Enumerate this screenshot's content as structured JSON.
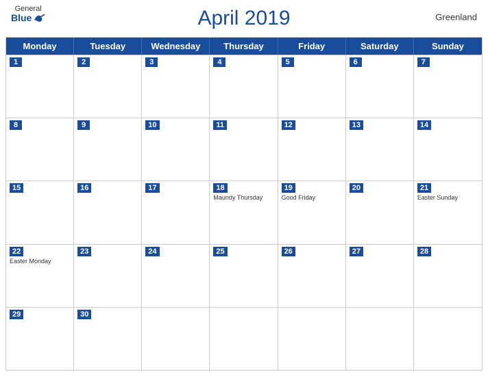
{
  "header": {
    "logo_general": "General",
    "logo_blue": "Blue",
    "title": "April 2019",
    "region": "Greenland"
  },
  "day_headers": [
    "Monday",
    "Tuesday",
    "Wednesday",
    "Thursday",
    "Friday",
    "Saturday",
    "Sunday"
  ],
  "weeks": [
    [
      {
        "date": "1",
        "holiday": ""
      },
      {
        "date": "2",
        "holiday": ""
      },
      {
        "date": "3",
        "holiday": ""
      },
      {
        "date": "4",
        "holiday": ""
      },
      {
        "date": "5",
        "holiday": ""
      },
      {
        "date": "6",
        "holiday": ""
      },
      {
        "date": "7",
        "holiday": ""
      }
    ],
    [
      {
        "date": "8",
        "holiday": ""
      },
      {
        "date": "9",
        "holiday": ""
      },
      {
        "date": "10",
        "holiday": ""
      },
      {
        "date": "11",
        "holiday": ""
      },
      {
        "date": "12",
        "holiday": ""
      },
      {
        "date": "13",
        "holiday": ""
      },
      {
        "date": "14",
        "holiday": ""
      }
    ],
    [
      {
        "date": "15",
        "holiday": ""
      },
      {
        "date": "16",
        "holiday": ""
      },
      {
        "date": "17",
        "holiday": ""
      },
      {
        "date": "18",
        "holiday": "Maundy Thursday"
      },
      {
        "date": "19",
        "holiday": "Good Friday"
      },
      {
        "date": "20",
        "holiday": ""
      },
      {
        "date": "21",
        "holiday": "Easter Sunday"
      }
    ],
    [
      {
        "date": "22",
        "holiday": "Easter Monday"
      },
      {
        "date": "23",
        "holiday": ""
      },
      {
        "date": "24",
        "holiday": ""
      },
      {
        "date": "25",
        "holiday": ""
      },
      {
        "date": "26",
        "holiday": ""
      },
      {
        "date": "27",
        "holiday": ""
      },
      {
        "date": "28",
        "holiday": ""
      }
    ],
    [
      {
        "date": "29",
        "holiday": ""
      },
      {
        "date": "30",
        "holiday": ""
      },
      {
        "date": "",
        "holiday": ""
      },
      {
        "date": "",
        "holiday": ""
      },
      {
        "date": "",
        "holiday": ""
      },
      {
        "date": "",
        "holiday": ""
      },
      {
        "date": "",
        "holiday": ""
      }
    ]
  ]
}
